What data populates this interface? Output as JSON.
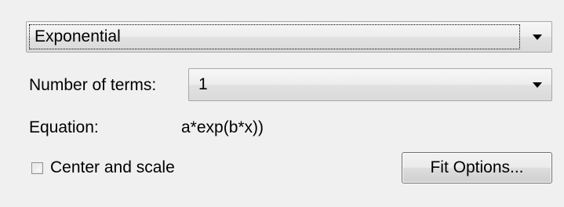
{
  "fit_type": {
    "selected": "Exponential"
  },
  "terms": {
    "label": "Number of terms:",
    "selected": "1"
  },
  "equation": {
    "label": "Equation:",
    "value": "a*exp(b*x))"
  },
  "center_scale": {
    "label": "Center and scale",
    "checked": false
  },
  "fit_options_button": {
    "label": "Fit Options..."
  }
}
